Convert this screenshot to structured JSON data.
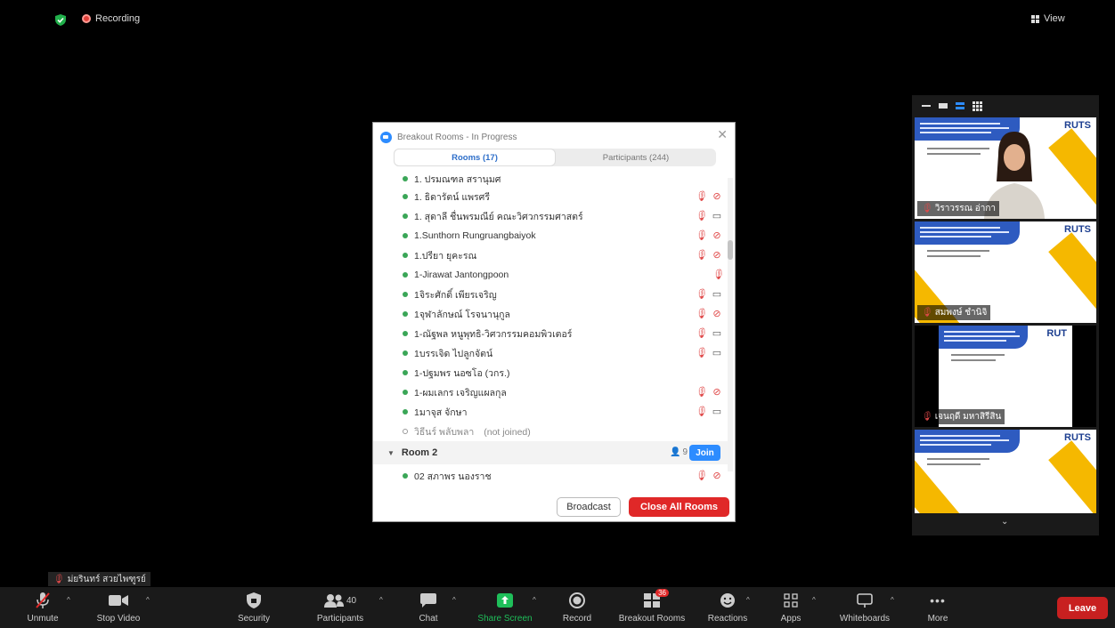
{
  "topbar": {
    "recording_label": "Recording",
    "view_label": "View"
  },
  "dialog": {
    "title": "Breakout Rooms - In Progress",
    "tabs": {
      "rooms": "Rooms (17)",
      "participants": "Participants (244)"
    },
    "members": [
      {
        "name": "1. ปรมณฑล สรานุมศ",
        "mic": false,
        "cam": "none"
      },
      {
        "name": "1. ธิดารัตน์ แพรศรี",
        "mic": true,
        "cam": "off"
      },
      {
        "name": "1. สุดาลี ชื่นพรมณีย์ คณะวิศวกรรมศาสตร์",
        "mic": true,
        "cam": "on"
      },
      {
        "name": "1.Sunthorn Rungruangbaiyok",
        "mic": true,
        "cam": "off"
      },
      {
        "name": "1.ปรียา ยุคะรณ",
        "mic": true,
        "cam": "off"
      },
      {
        "name": "1-Jirawat Jantongpoon",
        "mic": true,
        "cam": "none"
      },
      {
        "name": "1จิระศักดิ์ เพียรเจริญ",
        "mic": true,
        "cam": "on"
      },
      {
        "name": "1จุฬาลักษณ์ โรจนานุกูล",
        "mic": true,
        "cam": "off"
      },
      {
        "name": "1-ณัฐพล หนูพุทธิ-วิศวกรรมคอมพิวเตอร์",
        "mic": true,
        "cam": "on"
      },
      {
        "name": "1บรรเจิด ไปลูกจัตน์",
        "mic": true,
        "cam": "on"
      },
      {
        "name": "1-ปฐมพร นอซโอ (วกร.)",
        "mic": false,
        "cam": "none"
      },
      {
        "name": "1-ผมเลกร เจริญแผลกุล",
        "mic": true,
        "cam": "off"
      },
      {
        "name": "1มาจุส จักษา",
        "mic": true,
        "cam": "on"
      }
    ],
    "not_joined": {
      "name": "วิธีนร์ พลับพลา",
      "status": "(not joined)"
    },
    "room2": {
      "name": "Room 2",
      "count": "9",
      "join_label": "Join"
    },
    "room2_member": {
      "name": "02 สุภาพร นองราช",
      "mic": true,
      "cam": "off"
    },
    "broadcast_label": "Broadcast",
    "close_all_label": "Close All Rooms"
  },
  "videos": [
    {
      "name": "วิราวรรณ อ่ากา",
      "logo": "RUTS"
    },
    {
      "name": "สมพงษ์ ชำนิจิ",
      "logo": "RUTS"
    },
    {
      "name": "เจนฤดี มหาสิรีสิน",
      "logo": "RUT"
    },
    {
      "name": "",
      "logo": "RUTS"
    }
  ],
  "self_label": "ม่ยรินทร์ สวยไพฑูรย์",
  "toolbar": {
    "unmute": "Unmute",
    "stop_video": "Stop Video",
    "security": "Security",
    "participants": "Participants",
    "participants_count": "40",
    "chat": "Chat",
    "share_screen": "Share Screen",
    "record": "Record",
    "breakout_rooms": "Breakout Rooms",
    "breakout_badge": "36",
    "reactions": "Reactions",
    "apps": "Apps",
    "whiteboards": "Whiteboards",
    "more": "More",
    "leave": "Leave"
  },
  "colors": {
    "accent_blue": "#2d8cff",
    "danger_red": "#e02828",
    "share_green": "#1fbf5a"
  }
}
